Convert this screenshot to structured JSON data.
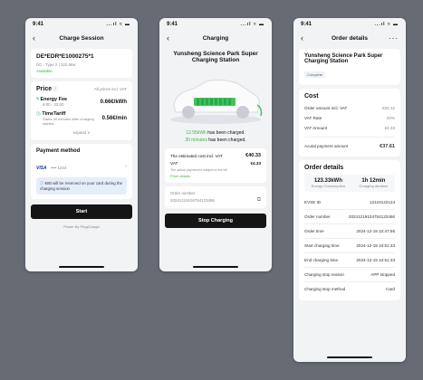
{
  "time": "9:41",
  "signal": "...ıl ≈ ▬",
  "p1": {
    "title": "Charge Session",
    "station_id": "DE*EDR*E1000275*1",
    "connector": "DC · Type 2 | 122.5kw",
    "status": "Available",
    "price_title": "Price",
    "price_note": "All prices incl. VAT",
    "energy_fee_label": "Energy Fee",
    "energy_fee_hours": "6:00 - 22:00",
    "energy_fee_value": "0.66€/kWh",
    "time_tariff_label": "TimeTariff",
    "time_tariff_desc": "Starts 30 minutes after charging started.",
    "time_tariff_value": "0.56€/min",
    "expand": "expand ∨",
    "payment_title": "Payment method",
    "card_brand": "VISA",
    "card_number": "•••• 1234",
    "reserve_note": "€80 will be reserved on your card during the charging session",
    "start": "Start",
    "powered": "Power By PlugCharge"
  },
  "p2": {
    "title": "Charging",
    "station": "Yunsheng Science Park Super Charging Station",
    "charged_kwh": "12.55kWh",
    "charged_kwh_tail": " has been charged.",
    "charged_min": "30 minutes",
    "charged_min_tail": " has been charged.",
    "est_cost_label": "The estimated cost incl. VAT",
    "est_cost_value": "€40.33",
    "vat_label": "VAT",
    "vat_value": "€4.33",
    "actual_note": "The actual payment is subject to the bill.",
    "price_details": "Price details",
    "order_number_label": "Order number",
    "order_number": "20241219104754123456",
    "stop": "Stop Charging"
  },
  "p3": {
    "title": "Order details",
    "more": "···",
    "station": "Yunsheng Science Park Super Charging Station",
    "status": "Complete",
    "cost_title": "Cost",
    "order_amount_label": "Order amount incl. VAT",
    "order_amount": "€32.12",
    "vat_rate_label": "VAT Rate",
    "vat_rate": "20%",
    "vat_amount_label": "VAT Amount",
    "vat_amount": "€4.33",
    "actual_label": "Acutal payment amount",
    "actual_amount": "€37.61",
    "details_title": "Order details",
    "energy_val": "123.33kWh",
    "energy_lbl": "Energy Consumption",
    "duration_val": "1h 12min",
    "duration_lbl": "Charging duration",
    "rows": [
      {
        "k": "EVSE ID",
        "v": "12124122123"
      },
      {
        "k": "Order number",
        "v": "20241219104754123456"
      },
      {
        "k": "Order time",
        "v": "2024-12-19 10:47:56"
      },
      {
        "k": "Start charging time",
        "v": "2024-12-19 10:51:33"
      },
      {
        "k": "End charging time",
        "v": "2024-12-19 10:51:33"
      },
      {
        "k": "Charging stop reason",
        "v": "APP stopped"
      },
      {
        "k": "Charging stop method",
        "v": "Card"
      }
    ]
  }
}
